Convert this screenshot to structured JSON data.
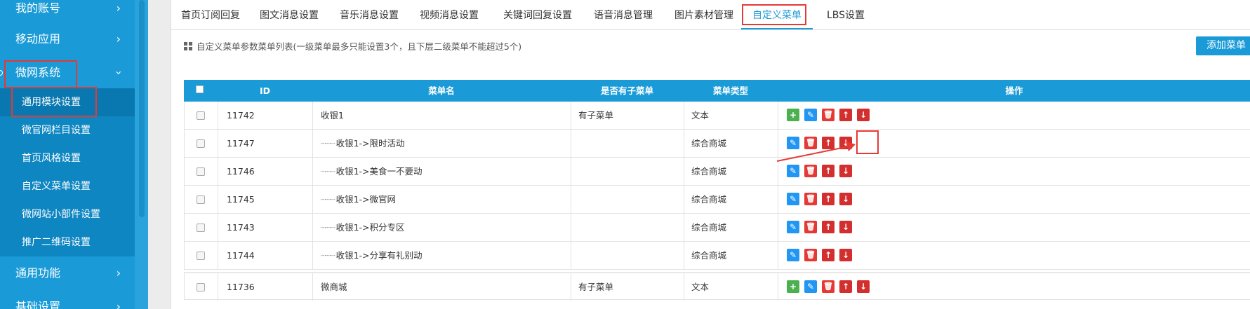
{
  "sidebar": {
    "groups": [
      {
        "label": "我的账号"
      },
      {
        "label": "移动应用"
      },
      {
        "label": "微网系统"
      },
      {
        "label": "通用功能"
      },
      {
        "label": "基础设置"
      }
    ],
    "weiwang_children": [
      {
        "label": "通用模块设置"
      },
      {
        "label": "微官网栏目设置"
      },
      {
        "label": "首页风格设置"
      },
      {
        "label": "自定义菜单设置"
      },
      {
        "label": "微网站小部件设置"
      },
      {
        "label": "推广二维码设置"
      }
    ]
  },
  "tabs": [
    {
      "label": "首页订阅回复"
    },
    {
      "label": "图文消息设置"
    },
    {
      "label": "音乐消息设置"
    },
    {
      "label": "视频消息设置"
    },
    {
      "label": "关键词回复设置"
    },
    {
      "label": "语音消息管理"
    },
    {
      "label": "图片素材管理"
    },
    {
      "label": "自定义菜单"
    },
    {
      "label": "LBS设置"
    }
  ],
  "info_text": "自定义菜单参数菜单列表(一级菜单最多只能设置3个，且下层二级菜单不能超过5个)",
  "add_button_label": "添加菜单",
  "table": {
    "headers": {
      "id": "ID",
      "name": "菜单名",
      "has_sub": "是否有子菜单",
      "type": "菜单类型",
      "ops": "操作"
    },
    "rows": [
      {
        "id": "11742",
        "name": "收银1",
        "child": false,
        "has_sub": "有子菜单",
        "type": "文本"
      },
      {
        "id": "11747",
        "name": "收银1->限时活动",
        "child": true,
        "has_sub": "",
        "type": "综合商城"
      },
      {
        "id": "11746",
        "name": "收银1->美食一不要动",
        "child": true,
        "has_sub": "",
        "type": "综合商城"
      },
      {
        "id": "11745",
        "name": "收银1->微官网",
        "child": true,
        "has_sub": "",
        "type": "综合商城"
      },
      {
        "id": "11743",
        "name": "收银1->积分专区",
        "child": true,
        "has_sub": "",
        "type": "综合商城"
      },
      {
        "id": "11744",
        "name": "收银1->分享有礼别动",
        "child": true,
        "has_sub": "",
        "type": "综合商城"
      },
      {
        "id": "11736",
        "name": "微商城",
        "child": false,
        "has_sub": "有子菜单",
        "type": "文本"
      }
    ],
    "tree_prefix": "┈┈┈"
  },
  "icons": {
    "add": "add-submenu-icon",
    "edit": "edit-icon",
    "delete": "trash-icon",
    "up": "arrow-up-icon",
    "down": "arrow-down-icon"
  },
  "colors": {
    "primary": "#1a9bd7",
    "danger": "#e53935",
    "success": "#4caf50",
    "highlight": "#e53935"
  }
}
